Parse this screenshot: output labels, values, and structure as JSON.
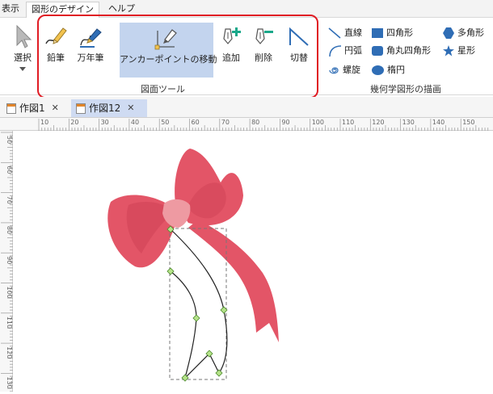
{
  "menubar": {
    "tabs": [
      {
        "label": "表示",
        "active": false
      },
      {
        "label": "図形のデザイン",
        "active": true
      },
      {
        "label": "ヘルプ",
        "active": false
      }
    ]
  },
  "ribbon": {
    "select_label": "選択",
    "tools": {
      "pencil": "鉛筆",
      "fountain_pen": "万年筆",
      "move_anchor": "アンカーポイントの移動",
      "add": "追加",
      "delete": "削除",
      "toggle": "切替"
    },
    "tools_group_label": "図面ツール",
    "shapes": {
      "line": "直線",
      "rectangle": "四角形",
      "polygon": "多角形",
      "arc": "円弧",
      "rounded_rect": "角丸四角形",
      "star": "星形",
      "spiral": "螺旋",
      "ellipse": "楕円"
    },
    "shapes_group_label": "幾何学図形の描画"
  },
  "documents": {
    "tabs": [
      {
        "label": "作図1",
        "active": false
      },
      {
        "label": "作図12",
        "active": true
      }
    ]
  },
  "rulers": {
    "horizontal": [
      "10",
      "20",
      "30",
      "40",
      "50",
      "60",
      "70",
      "80",
      "90",
      "100",
      "110",
      "120",
      "130",
      "140",
      "150"
    ],
    "vertical": [
      "50",
      "60",
      "70",
      "80",
      "90",
      "100",
      "110",
      "120",
      "130"
    ]
  },
  "colors": {
    "accent_selected": "#c3d4ee",
    "highlight": "#e01c24",
    "ribbon_pink": "#e35567",
    "knot_pink": "#ee9aa2",
    "shape_blue": "#2f6db5",
    "anchor_green": "#b6e38a"
  }
}
